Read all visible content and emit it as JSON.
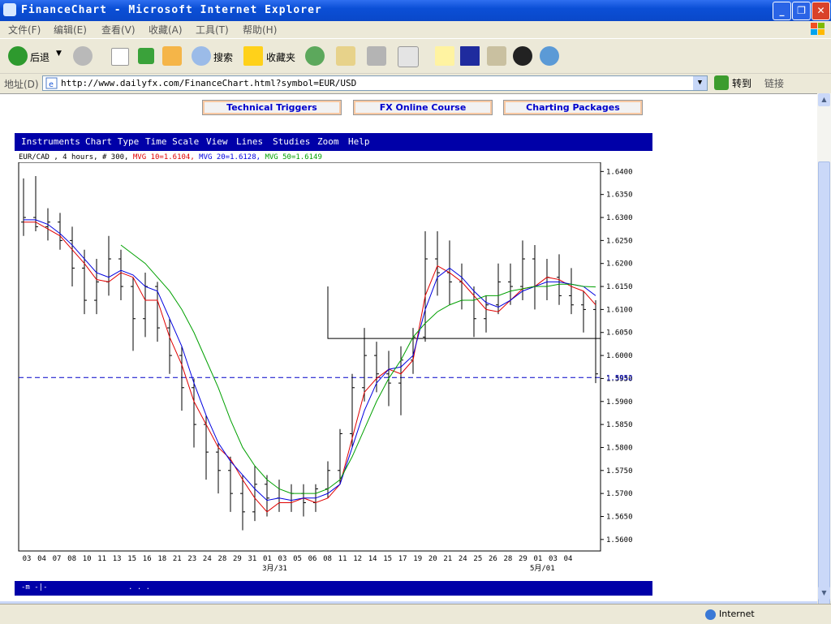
{
  "window": {
    "title": "FinanceChart - Microsoft Internet Explorer",
    "min": "_",
    "max": "❐",
    "close": "✕"
  },
  "menu": [
    "文件(F)",
    "编辑(E)",
    "查看(V)",
    "收藏(A)",
    "工具(T)",
    "帮助(H)"
  ],
  "toolbar": {
    "back": "后退",
    "search": "搜索",
    "favorites": "收藏夹"
  },
  "address": {
    "label": "地址(D)",
    "url": "http://www.dailyfx.com/FinanceChart.html?symbol=EUR/USD",
    "go": "转到",
    "links": "链接"
  },
  "page": {
    "nav_buttons": [
      "Technical Triggers",
      "FX Online Course",
      "Charting Packages"
    ]
  },
  "chart_menu": [
    "Instruments",
    "Chart Type",
    "Time Scale",
    "View",
    "Lines",
    "Studies",
    "Zoom",
    "Help"
  ],
  "legend": {
    "instrument": "EUR/CAD , 4 hours, # 300,",
    "mvg10": "MVG 10=1.6104,",
    "mvg20": "MVG 20=1.6128,",
    "mvg50": "MVG 50=1.6149"
  },
  "status": {
    "zone": "Internet"
  },
  "chart_data": {
    "type": "bar",
    "subtype": "ohlc",
    "instrument": "EUR/CAD",
    "timeframe": "4 hours",
    "bars": 300,
    "y_ticks": [
      "1.6400",
      "1.6350",
      "1.6300",
      "1.6250",
      "1.6200",
      "1.6150",
      "1.6100",
      "1.6050",
      "1.6000",
      "1.5950",
      "1.5900",
      "1.5850",
      "1.5800",
      "1.5750",
      "1.5700",
      "1.5650",
      "1.5600"
    ],
    "ylim": [
      1.5575,
      1.642
    ],
    "current_price_line": 1.5952,
    "current_price_label": "1.5952",
    "x_ticks": [
      "03",
      "04",
      "07",
      "08",
      "10",
      "11",
      "13",
      "15",
      "16",
      "18",
      "21",
      "23",
      "24",
      "28",
      "29",
      "31",
      "01",
      "03",
      "05",
      "06",
      "08",
      "11",
      "12",
      "14",
      "15",
      "17",
      "19",
      "20",
      "21",
      "24",
      "25",
      "26",
      "28",
      "29",
      "01",
      "03",
      "04"
    ],
    "month_labels": [
      "3月/31",
      "5月/01"
    ],
    "support_box": {
      "from_index": 25,
      "to_index": 36,
      "top": 1.615,
      "bottom": 1.6037
    },
    "series": [
      {
        "name": "MVG 10",
        "color": "#e00000",
        "values": [
          1.629,
          1.629,
          1.6275,
          1.626,
          1.623,
          1.62,
          1.6165,
          1.616,
          1.618,
          1.617,
          1.612,
          1.612,
          1.604,
          1.598,
          1.59,
          1.585,
          1.58,
          1.5775,
          1.573,
          1.569,
          1.566,
          1.568,
          1.568,
          1.569,
          1.568,
          1.569,
          1.572,
          1.582,
          1.592,
          1.595,
          1.597,
          1.596,
          1.599,
          1.613,
          1.6195,
          1.618,
          1.616,
          1.613,
          1.61,
          1.6095,
          1.612,
          1.6145,
          1.615,
          1.617,
          1.6165,
          1.615,
          1.614,
          1.611
        ]
      },
      {
        "name": "MVG 20",
        "color": "#0000e0",
        "values": [
          1.6295,
          1.6295,
          1.6285,
          1.6265,
          1.624,
          1.621,
          1.618,
          1.617,
          1.6185,
          1.6175,
          1.615,
          1.614,
          1.608,
          1.602,
          1.594,
          1.587,
          1.581,
          1.577,
          1.574,
          1.571,
          1.5685,
          1.569,
          1.5685,
          1.569,
          1.569,
          1.57,
          1.572,
          1.58,
          1.588,
          1.594,
          1.597,
          1.5975,
          1.6,
          1.61,
          1.617,
          1.619,
          1.617,
          1.614,
          1.6115,
          1.6105,
          1.612,
          1.614,
          1.615,
          1.616,
          1.616,
          1.6155,
          1.615,
          1.613
        ]
      },
      {
        "name": "MVG 50",
        "color": "#00a000",
        "values": [
          null,
          null,
          null,
          null,
          null,
          null,
          null,
          null,
          1.624,
          1.622,
          1.62,
          1.617,
          1.614,
          1.61,
          1.605,
          1.599,
          1.593,
          1.586,
          1.58,
          1.576,
          1.573,
          1.571,
          1.57,
          1.57,
          1.57,
          1.571,
          1.573,
          1.578,
          1.584,
          1.59,
          1.595,
          1.599,
          1.604,
          1.607,
          1.6095,
          1.611,
          1.612,
          1.612,
          1.613,
          1.613,
          1.614,
          1.6145,
          1.615,
          1.615,
          1.6155,
          1.6155,
          1.615,
          1.6149
        ]
      }
    ],
    "ohlc": [
      [
        1.629,
        1.6385,
        1.626,
        1.63
      ],
      [
        1.63,
        1.639,
        1.627,
        1.628
      ],
      [
        1.628,
        1.632,
        1.625,
        1.629
      ],
      [
        1.629,
        1.631,
        1.623,
        1.625
      ],
      [
        1.625,
        1.628,
        1.615,
        1.619
      ],
      [
        1.619,
        1.623,
        1.609,
        1.612
      ],
      [
        1.612,
        1.621,
        1.609,
        1.616
      ],
      [
        1.616,
        1.626,
        1.613,
        1.621
      ],
      [
        1.621,
        1.623,
        1.612,
        1.615
      ],
      [
        1.615,
        1.617,
        1.601,
        1.608
      ],
      [
        1.608,
        1.618,
        1.604,
        1.615
      ],
      [
        1.615,
        1.616,
        1.603,
        1.606
      ],
      [
        1.606,
        1.608,
        1.596,
        1.6
      ],
      [
        1.6,
        1.602,
        1.588,
        1.593
      ],
      [
        1.593,
        1.595,
        1.58,
        1.585
      ],
      [
        1.585,
        1.587,
        1.573,
        1.579
      ],
      [
        1.579,
        1.581,
        1.57,
        1.575
      ],
      [
        1.575,
        1.578,
        1.566,
        1.57
      ],
      [
        1.57,
        1.574,
        1.562,
        1.566
      ],
      [
        1.566,
        1.576,
        1.564,
        1.572
      ],
      [
        1.572,
        1.574,
        1.565,
        1.569
      ],
      [
        1.569,
        1.573,
        1.566,
        1.568
      ],
      [
        1.568,
        1.572,
        1.566,
        1.57
      ],
      [
        1.57,
        1.572,
        1.565,
        1.568
      ],
      [
        1.568,
        1.572,
        1.566,
        1.571
      ],
      [
        1.571,
        1.577,
        1.569,
        1.575
      ],
      [
        1.575,
        1.584,
        1.572,
        1.583
      ],
      [
        1.583,
        1.596,
        1.58,
        1.593
      ],
      [
        1.593,
        1.606,
        1.59,
        1.6
      ],
      [
        1.6,
        1.603,
        1.592,
        1.596
      ],
      [
        1.596,
        1.601,
        1.589,
        1.594
      ],
      [
        1.594,
        1.602,
        1.587,
        1.599
      ],
      [
        1.599,
        1.606,
        1.596,
        1.604
      ],
      [
        1.604,
        1.627,
        1.603,
        1.621
      ],
      [
        1.621,
        1.627,
        1.613,
        1.618
      ],
      [
        1.618,
        1.625,
        1.611,
        1.616
      ],
      [
        1.616,
        1.62,
        1.61,
        1.612
      ],
      [
        1.612,
        1.615,
        1.604,
        1.608
      ],
      [
        1.608,
        1.613,
        1.605,
        1.611
      ],
      [
        1.611,
        1.62,
        1.609,
        1.616
      ],
      [
        1.616,
        1.62,
        1.611,
        1.615
      ],
      [
        1.615,
        1.625,
        1.612,
        1.621
      ],
      [
        1.621,
        1.624,
        1.61,
        1.615
      ],
      [
        1.615,
        1.621,
        1.612,
        1.617
      ],
      [
        1.617,
        1.622,
        1.611,
        1.613
      ],
      [
        1.613,
        1.619,
        1.609,
        1.611
      ],
      [
        1.611,
        1.614,
        1.605,
        1.61
      ],
      [
        1.61,
        1.612,
        1.594,
        1.596
      ]
    ]
  },
  "chart_footer": {
    "icons": "-m   -|-",
    "dots": ". . ."
  }
}
